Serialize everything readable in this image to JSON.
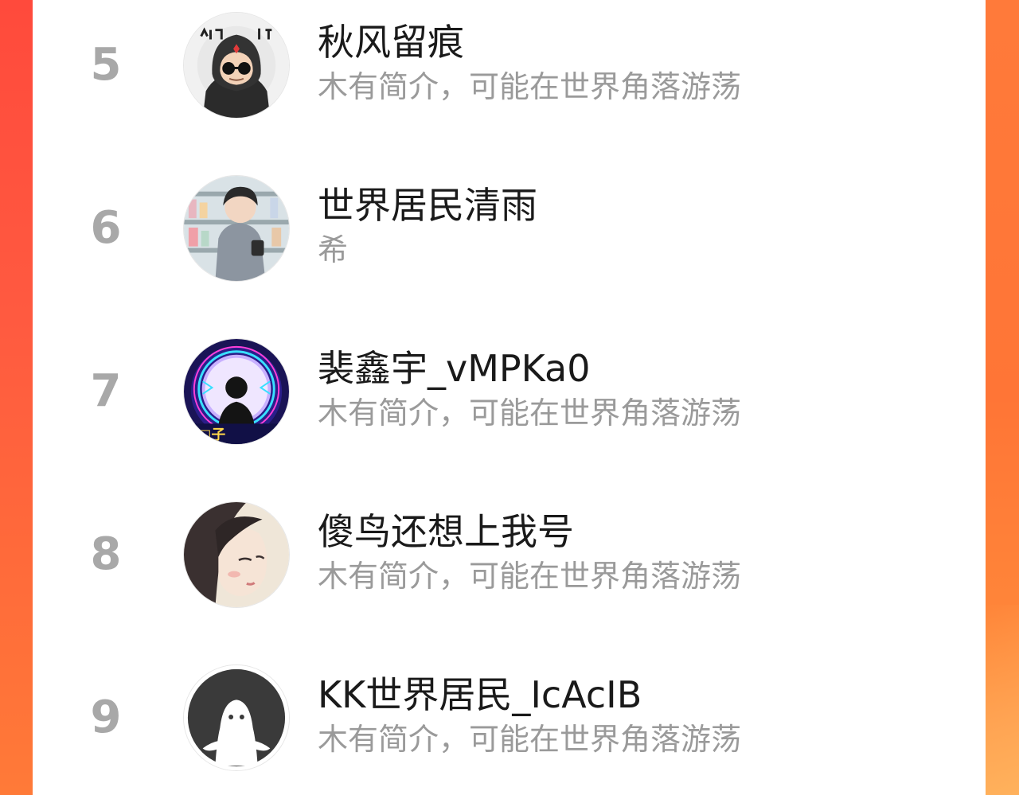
{
  "theme": {
    "background_accent": "#ff4f3d",
    "panel_background": "#ffffff",
    "rank_color": "#a8a8a8",
    "name_color": "#1a1a1a",
    "bio_color": "#9a9a9a"
  },
  "ranking": {
    "items": [
      {
        "rank": "5",
        "name": "秋风留痕",
        "bio": "木有简介，可能在世界角落游荡",
        "avatar_icon": "hooded-figure-sunglasses-avatar"
      },
      {
        "rank": "6",
        "name": "世界居民清雨",
        "bio": "希",
        "avatar_icon": "boy-in-shop-avatar"
      },
      {
        "rank": "7",
        "name": "裴鑫宇_vMPKa0",
        "bio": "木有简介，可能在世界角落游荡",
        "avatar_icon": "neon-silhouette-avatar"
      },
      {
        "rank": "8",
        "name": "傻鸟还想上我号",
        "bio": "木有简介，可能在世界角落游荡",
        "avatar_icon": "illustrated-girl-avatar"
      },
      {
        "rank": "9",
        "name": "KK世界居民_IcAcIB",
        "bio": "木有简介，可能在世界角落游荡",
        "avatar_icon": "default-ghost-avatar"
      }
    ]
  }
}
